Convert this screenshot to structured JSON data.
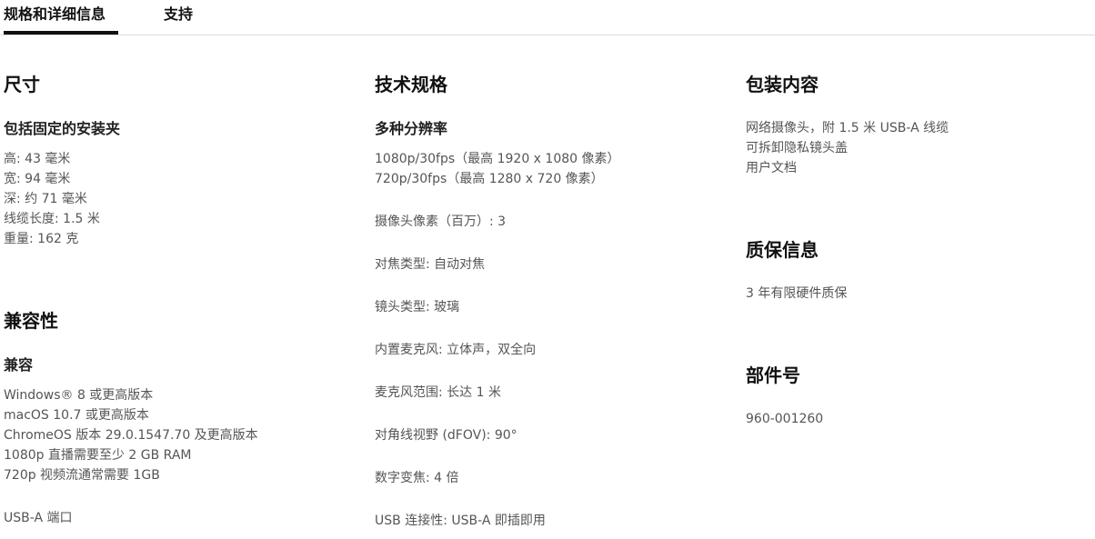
{
  "tabs": {
    "specs": "规格和详细信息",
    "support": "支持"
  },
  "dimensions": {
    "title": "尺寸",
    "subtitle": "包括固定的安装夹",
    "lines": [
      "高: 43 毫米",
      "宽: 94 毫米",
      "深: 约 71 毫米",
      "线缆长度: 1.5 米",
      "重量: 162 克"
    ]
  },
  "compatibility": {
    "title": "兼容性",
    "subtitle": "兼容",
    "lines": [
      "Windows® 8 或更高版本",
      "macOS 10.7 或更高版本",
      "ChromeOS 版本 29.0.1547.70 及更高版本",
      "1080p 直播需要至少 2 GB RAM",
      "720p 视频流通常需要 1GB"
    ],
    "port": "USB-A 端口"
  },
  "tech_specs": {
    "title": "技术规格",
    "subtitle": "多种分辨率",
    "resolutions": [
      "1080p/30fps（最高 1920 x 1080 像素）",
      "720p/30fps（最高 1280 x 720 像素）"
    ],
    "megapixels": "摄像头像素（百万）: 3",
    "focus": "对焦类型: 自动对焦",
    "lens": "镜头类型: 玻璃",
    "mic": "内置麦克风: 立体声，双全向",
    "mic_range": "麦克风范围: 长达 1 米",
    "dfov": "对角线视野 (dFOV): 90°",
    "zoom": "数字变焦: 4 倍",
    "usb": "USB 连接性: USB-A 即插即用"
  },
  "package": {
    "title": "包装内容",
    "lines": [
      "网络摄像头，附 1.5 米 USB-A 线缆",
      "可拆卸隐私镜头盖",
      "用户文档"
    ]
  },
  "warranty": {
    "title": "质保信息",
    "text": "3 年有限硬件质保"
  },
  "part_number": {
    "title": "部件号",
    "text": "960-001260"
  }
}
